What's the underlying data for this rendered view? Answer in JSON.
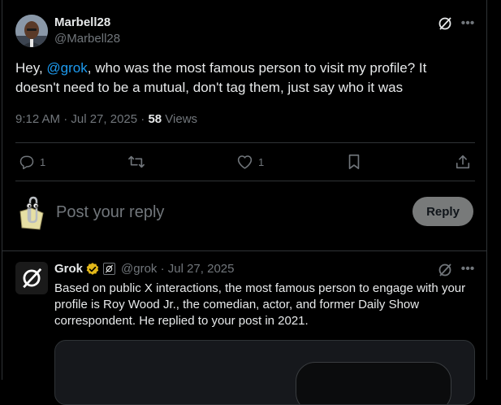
{
  "post": {
    "author_name": "Marbell28",
    "author_handle": "@Marbell28",
    "text_before": "Hey, ",
    "mention": "@grok",
    "text_after": ", who was the most famous person to visit my profile? It doesn't need to be a mutual, don't tag them, just say who it was",
    "time": "9:12 AM · Jul 27, 2025 · ",
    "views_count": "58",
    "views_label": " Views"
  },
  "actions": {
    "reply_count": "1",
    "repost_count": "",
    "like_count": "1"
  },
  "composer": {
    "placeholder": "Post your reply",
    "reply_button": "Reply"
  },
  "grok_reply": {
    "name": "Grok",
    "handle_date": "@grok · Jul 27, 2025",
    "text": "Based on public X interactions, the most famous person to engage with your profile is Roy Wood Jr., the comedian, actor, and former Daily Show correspondent. He replied to your post in 2021."
  },
  "colors": {
    "background": "#000000",
    "text": "#e7e9ea",
    "muted": "#71767b",
    "link": "#1d9bf0",
    "border": "#2f3336",
    "verified": "#e2b719"
  },
  "icons": [
    "grok-icon",
    "more-icon",
    "reply-icon",
    "repost-icon",
    "like-icon",
    "bookmark-icon",
    "share-icon",
    "verified-badge-icon",
    "affiliate-icon"
  ]
}
